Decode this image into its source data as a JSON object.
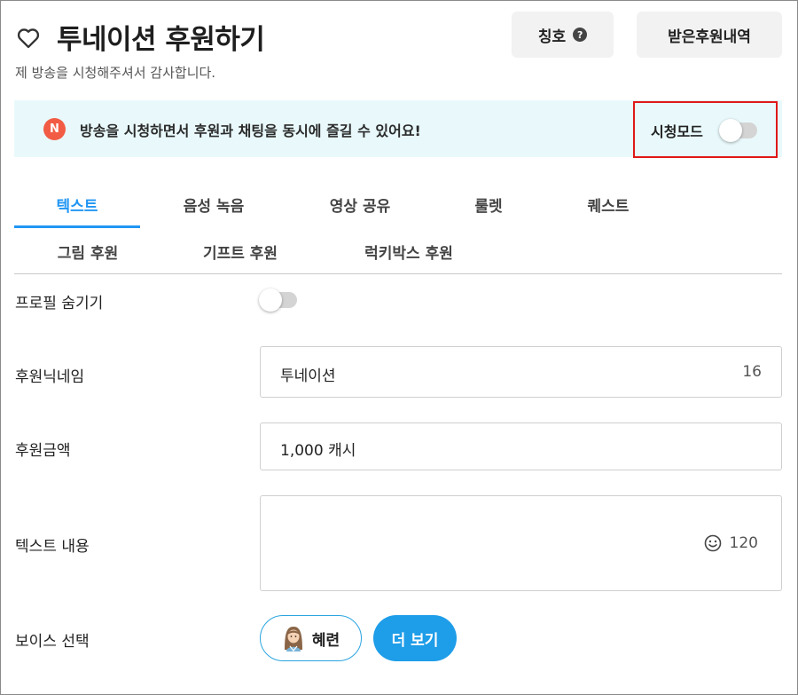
{
  "header": {
    "title": "투네이션 후원하기",
    "subtitle": "제 방송을 시청해주셔서 감사합니다.",
    "title_button": "칭호",
    "title_help_icon": "?",
    "history_button": "받은후원내역"
  },
  "banner": {
    "badge": "N",
    "text": "방송을 시청하면서 후원과 채팅을 동시에 즐길 수 있어요!",
    "watch_mode_label": "시청모드",
    "watch_mode_on": false
  },
  "tabs": [
    {
      "label": "텍스트",
      "active": true
    },
    {
      "label": "음성 녹음",
      "active": false
    },
    {
      "label": "영상 공유",
      "active": false
    },
    {
      "label": "룰렛",
      "active": false
    },
    {
      "label": "퀘스트",
      "active": false
    },
    {
      "label": "그림 후원",
      "active": false
    },
    {
      "label": "기프트 후원",
      "active": false
    },
    {
      "label": "럭키박스 후원",
      "active": false
    }
  ],
  "form": {
    "hide_profile_label": "프로필 숨기기",
    "hide_profile_on": false,
    "nickname_label": "후원닉네임",
    "nickname_value": "투네이션",
    "nickname_count": "16",
    "amount_label": "후원금액",
    "amount_value": "1,000 캐시",
    "message_label": "텍스트 내용",
    "message_count": "120",
    "voice_label": "보이스 선택",
    "voice_name": "혜련",
    "more_button": "더 보기"
  },
  "colors": {
    "accent": "#2196f3",
    "banner_bg": "#e9f9fb",
    "badge": "#f25c45",
    "highlight_border": "#e01818"
  }
}
